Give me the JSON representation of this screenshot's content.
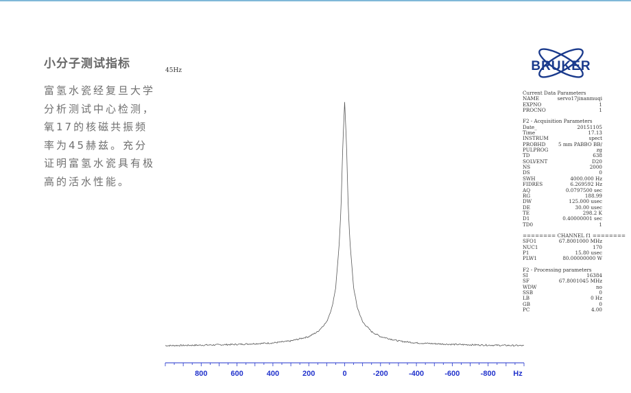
{
  "slide": {
    "heading": "小分子测试指标",
    "body": "富氢水瓷经复旦大学分析测试中心检测，氧17的核磁共振频率为45赫兹。充分证明富氢水瓷具有极高的活水性能。"
  },
  "logo": {
    "text": "BRUKER",
    "icon": "atom-orbit-icon",
    "color": "#1a3a8c"
  },
  "colors": {
    "axis": "#2233cc",
    "trace": "#555555",
    "top_rule": "#7fb8d8"
  },
  "chart_data": {
    "type": "line",
    "annotation": "45Hz",
    "x_unit": "Hz",
    "xlim": [
      1000,
      -1000
    ],
    "x_ticks": [
      800,
      600,
      400,
      200,
      0,
      -200,
      -400,
      -600,
      -800
    ],
    "x_tick_labels": [
      "800",
      "600",
      "400",
      "200",
      "0",
      "-200",
      "-400",
      "-600",
      "-800"
    ],
    "series": [
      {
        "x": [
          1000,
          800,
          600,
          400,
          300,
          200,
          150,
          100,
          70,
          50,
          30,
          20,
          10,
          0,
          -10,
          -20,
          -30,
          -50,
          -70,
          -100,
          -150,
          -200,
          -300,
          -400,
          -600,
          -800,
          -1000
        ],
        "y": [
          0.003,
          0.005,
          0.008,
          0.014,
          0.022,
          0.04,
          0.06,
          0.1,
          0.16,
          0.24,
          0.42,
          0.57,
          0.83,
          1.0,
          0.83,
          0.57,
          0.42,
          0.24,
          0.16,
          0.1,
          0.06,
          0.04,
          0.022,
          0.014,
          0.008,
          0.005,
          0.003
        ]
      }
    ]
  },
  "params": {
    "sections": [
      {
        "title": "Current Data Parameters",
        "rows": [
          [
            "NAME",
            "servo17jinanmuqi"
          ],
          [
            "EXPNO",
            "1"
          ],
          [
            "PROCNO",
            "1"
          ]
        ]
      },
      {
        "title": "F2 - Acquisition Parameters",
        "rows": [
          [
            "Date_",
            "20151105"
          ],
          [
            "Time",
            "17.13"
          ],
          [
            "INSTRUM",
            "spect"
          ],
          [
            "PROBHD",
            "5 mm PABBO BB/"
          ],
          [
            "PULPROG",
            "zg"
          ],
          [
            "TD",
            "638"
          ],
          [
            "SOLVENT",
            "D20"
          ],
          [
            "NS",
            "2000"
          ],
          [
            "DS",
            "0"
          ],
          [
            "SWH",
            "4000.000 Hz"
          ],
          [
            "FIDRES",
            "6.269592 Hz"
          ],
          [
            "AQ",
            "0.0797500 sec"
          ],
          [
            "RG",
            "188.99"
          ],
          [
            "DW",
            "125.000 usec"
          ],
          [
            "DE",
            "30.00 usec"
          ],
          [
            "TE",
            "298.2 K"
          ],
          [
            "D1",
            "0.40000001 sec"
          ],
          [
            "TD0",
            "1"
          ]
        ]
      },
      {
        "title": "======== CHANNEL f1 ========",
        "rows": [
          [
            "SFO1",
            "67.8001000 MHz"
          ],
          [
            "NUC1",
            "170"
          ],
          [
            "P1",
            "15.80 usec"
          ],
          [
            "PLW1",
            "80.00000000 W"
          ]
        ]
      },
      {
        "title": "F2 - Processing parameters",
        "rows": [
          [
            "SI",
            "16384"
          ],
          [
            "SF",
            "67.8001045 MHz"
          ],
          [
            "WDW",
            "no"
          ],
          [
            "SSB",
            "0"
          ],
          [
            "LB",
            "0 Hz"
          ],
          [
            "GB",
            "0"
          ],
          [
            "PC",
            "4.00"
          ]
        ]
      }
    ]
  }
}
